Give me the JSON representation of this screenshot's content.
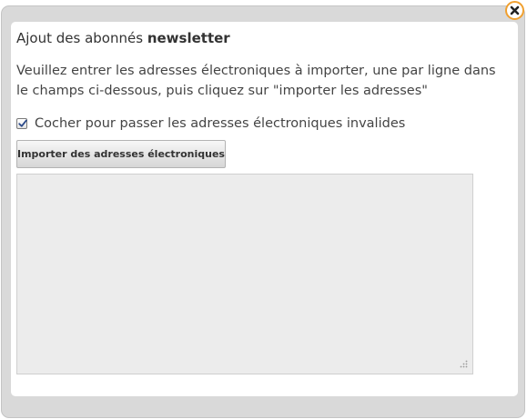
{
  "dialog": {
    "title_prefix": "Ajout des abonnés",
    "title_bold": "newsletter",
    "instructions": "Veuillez entrer les adresses électroniques à importer, une par ligne dans le champs ci-dessous, puis cliquez sur \"importer les adresses\"",
    "skip_invalid_checkbox": {
      "label": "Cocher pour passer les adresses électroniques invalides",
      "checked": true
    },
    "import_button_label": "Importer des adresses électroniques",
    "email_textarea_value": "",
    "close_icon": "close-icon"
  },
  "colors": {
    "frame": "#d9d9d9",
    "textarea_bg": "#ececec",
    "close_border": "#f0a030"
  }
}
